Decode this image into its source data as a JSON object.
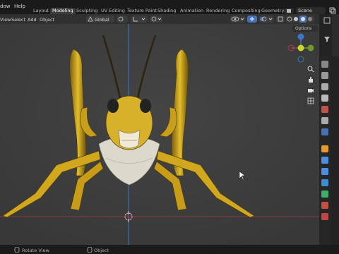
{
  "menu": {
    "window": "dow",
    "help": "Help"
  },
  "workspaces": [
    "Layout",
    "Modeling",
    "Sculpting",
    "UV Editing",
    "Texture Paint",
    "Shading",
    "Animation",
    "Rendering",
    "Compositing",
    "Geometry I"
  ],
  "active_workspace": "Modeling",
  "scene": {
    "label": "Scene"
  },
  "header": {
    "view": "View",
    "select": "Select",
    "add": "Add",
    "object": "Object",
    "orientation": "Global"
  },
  "viewport": {
    "options_label": "Options"
  },
  "gizmo": {
    "x": "X",
    "y": "Y",
    "z": "Z"
  },
  "status": {
    "rotate_view": "Rotate View",
    "object": "Object"
  },
  "colors": {
    "accent": "#4772b3",
    "viewport_bg": "#3d3d3d",
    "axis_x": "#b03a4a",
    "axis_y": "#6e9a2a",
    "axis_z": "#3b77c6",
    "model_yellow": "#d9b21f"
  }
}
